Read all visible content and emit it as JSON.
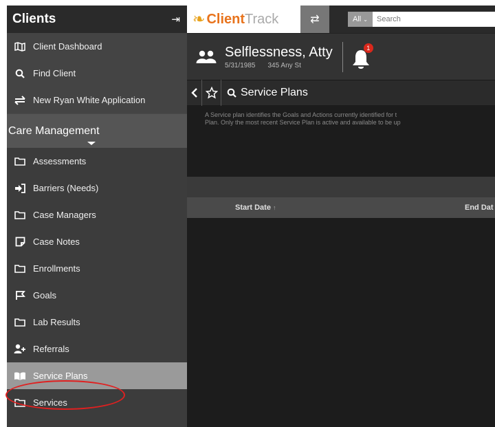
{
  "sidebar": {
    "title": "Clients",
    "top_items": [
      {
        "label": "Client Dashboard"
      },
      {
        "label": "Find Client"
      },
      {
        "label": "New Ryan White Application"
      }
    ],
    "section": "Care Management",
    "items": [
      {
        "label": "Assessments"
      },
      {
        "label": "Barriers (Needs)"
      },
      {
        "label": "Case Managers"
      },
      {
        "label": "Case Notes"
      },
      {
        "label": "Enrollments"
      },
      {
        "label": "Goals"
      },
      {
        "label": "Lab Results"
      },
      {
        "label": "Referrals"
      },
      {
        "label": "Service Plans"
      },
      {
        "label": "Services"
      }
    ]
  },
  "topbar": {
    "logo_part1": "Client",
    "logo_part2": "Track",
    "search_scope": "All",
    "search_placeholder": "Search"
  },
  "client": {
    "name": "Selflessness, Atty",
    "dob": "5/31/1985",
    "address": "345 Any St",
    "notification_count": "1"
  },
  "page": {
    "title": "Service Plans",
    "description_line1": "A Service plan identifies the Goals and Actions currently identified for t",
    "description_line2": "Plan.  Only the most recent Service Plan is active and available to be up"
  },
  "table": {
    "columns": [
      "Start Date",
      "End Dat"
    ]
  },
  "colors": {
    "accent": "#e8731c",
    "highlight_circle": "#e02020",
    "badge": "#d9281c"
  }
}
